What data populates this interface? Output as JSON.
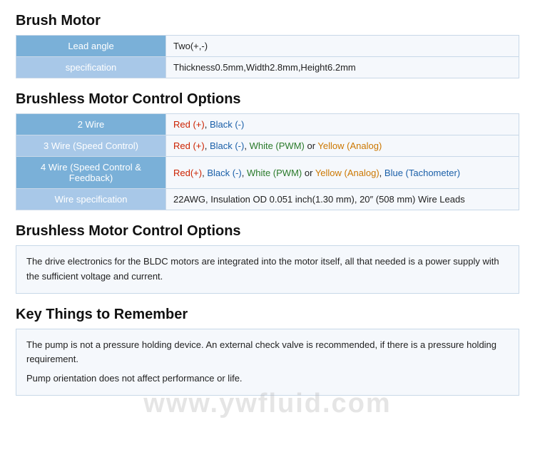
{
  "brush_motor": {
    "title": "Brush Motor",
    "rows": [
      {
        "label": "Lead angle",
        "value_plain": "Two(+,-)"
      },
      {
        "label": "specification",
        "value_plain": "Thickness0.5mm,Width2.8mm,Height6.2mm"
      }
    ]
  },
  "brushless_control": {
    "title": "Brushless Motor Control Options",
    "rows": [
      {
        "label": "2 Wire",
        "value": "2wire"
      },
      {
        "label": "3 Wire (Speed Control)",
        "value": "3wire"
      },
      {
        "label": "4 Wire (Speed Control & Feedback)",
        "value": "4wire"
      },
      {
        "label": "Wire specification",
        "value": "wirespec"
      }
    ]
  },
  "brushless_description": {
    "title": "Brushless Motor Control Options",
    "text": "The drive electronics for the BLDC motors are integrated into the motor itself, all that needed is a power supply with the sufficient voltage and current."
  },
  "key_things": {
    "title": "Key Things to Remember",
    "lines": [
      "The pump is not a pressure holding device. An external check valve is recommended, if there is a pressure holding requirement.",
      "Pump orientation does not affect performance or life."
    ]
  },
  "watermark": "www.ywfluid.com"
}
